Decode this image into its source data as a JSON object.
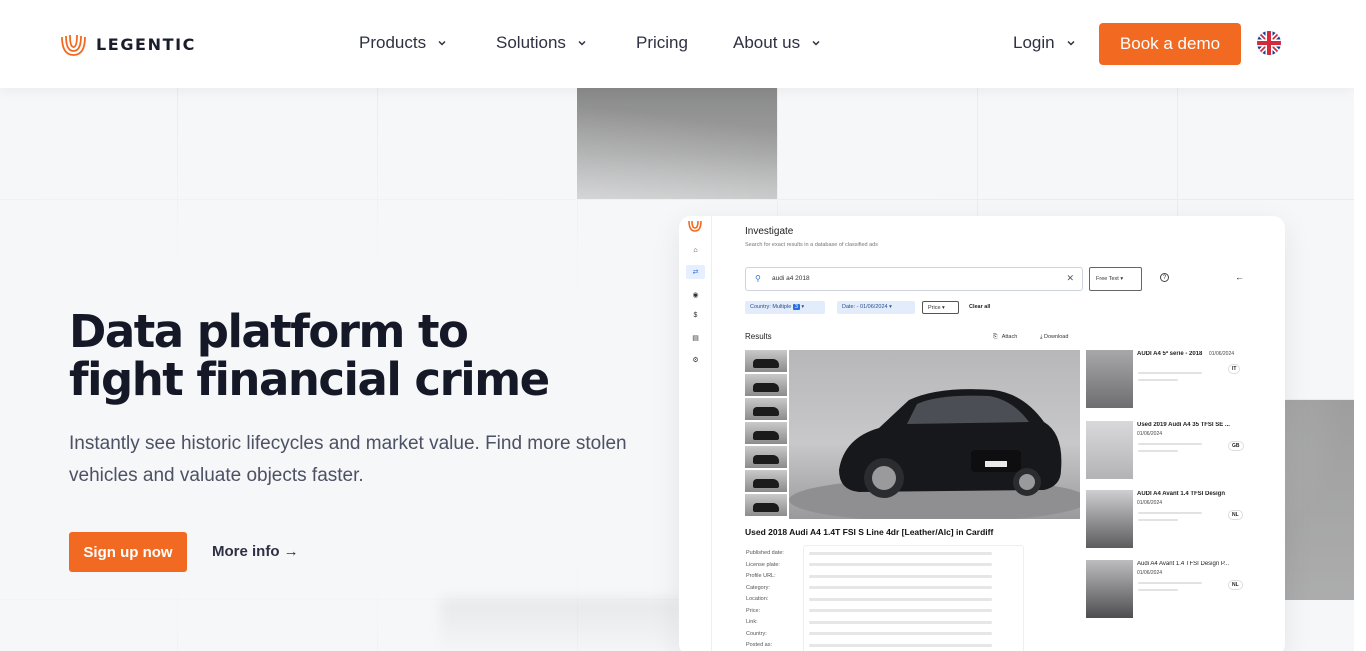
{
  "brand": {
    "name": "LEGENTIC",
    "accent": "#f26a21"
  },
  "nav": {
    "items": [
      {
        "label": "Products",
        "has_dropdown": true
      },
      {
        "label": "Solutions",
        "has_dropdown": true
      },
      {
        "label": "Pricing",
        "has_dropdown": false
      },
      {
        "label": "About us",
        "has_dropdown": true
      }
    ],
    "login_label": "Login",
    "demo_label": "Book a demo",
    "language_icon": "uk-flag-icon"
  },
  "hero": {
    "title_line1": "Data platform to",
    "title_line2": "fight financial crime",
    "subtitle": "Instantly see historic lifecycles and market value. Find more stolen vehicles and valuate objects faster.",
    "signup_label": "Sign up now",
    "more_info_label": "More info →"
  },
  "app_preview": {
    "title": "Investigate",
    "subtitle": "Search for exact results in a database of classified ads",
    "search_value": "audi a4 2018",
    "search_mode": "Free Text",
    "filters": {
      "country": "Country: Multiple",
      "country_count": "3",
      "date": "Date: - 01/06/2024",
      "price": "Price"
    },
    "clear_all": "Clear all",
    "results_label": "Results",
    "attach_label": "Attach",
    "download_label": "Download",
    "selected_title": "Used 2018 Audi A4 1.4T FSI S Line 4dr [Leather/Alc] in Cardiff",
    "detail_labels": [
      "Published date:",
      "License plate:",
      "Profile URL:",
      "Category:",
      "Location:",
      "Price:",
      "Link:",
      "Country:",
      "Posted as:"
    ],
    "results": [
      {
        "title": "AUDI A4 5ª serie - 2018",
        "date": "01/06/2024",
        "country": "IT"
      },
      {
        "title": "Used 2019 Audi A4 35 TFSI SE ...",
        "date": "01/06/2024",
        "country": "GB"
      },
      {
        "title": "AUDI A4 Avant 1.4 TFSI Design",
        "date": "01/06/2024",
        "country": "NL"
      },
      {
        "title": "Audi A4 Avant 1.4 TFSI Design P...",
        "date": "01/06/2024",
        "country": "NL"
      }
    ]
  }
}
